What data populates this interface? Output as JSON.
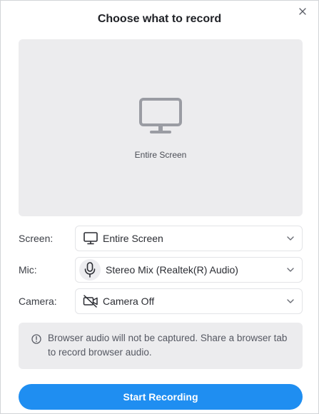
{
  "dialog": {
    "title": "Choose what to record",
    "close_icon": "close-icon"
  },
  "preview": {
    "icon": "monitor-icon",
    "label": "Entire Screen"
  },
  "fields": {
    "screen": {
      "label": "Screen:",
      "value": "Entire Screen",
      "icon": "monitor-icon"
    },
    "mic": {
      "label": "Mic:",
      "value": "Stereo Mix (Realtek(R) Audio)",
      "icon": "microphone-icon"
    },
    "camera": {
      "label": "Camera:",
      "value": "Camera Off",
      "icon": "camera-off-icon"
    }
  },
  "notice": {
    "icon": "info-icon",
    "text": "Browser audio will not be captured. Share a browser tab to record browser audio."
  },
  "actions": {
    "start_label": "Start Recording"
  },
  "colors": {
    "accent": "#1f8ef1",
    "panel": "#ececee",
    "icon_gray": "#9a9ca3"
  }
}
